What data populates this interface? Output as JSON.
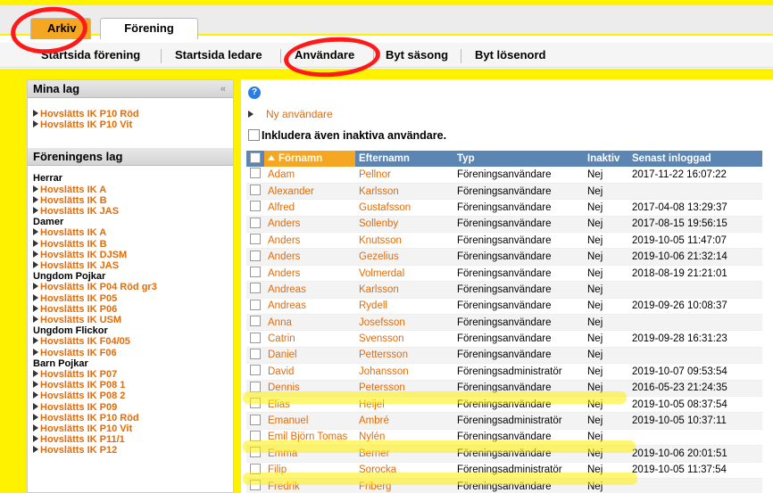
{
  "tabs": [
    {
      "label": "Arkiv",
      "active": true
    },
    {
      "label": "Förening",
      "active": false
    }
  ],
  "subnav": [
    "Startsida förening",
    "Startsida ledare",
    "Användare",
    "Byt säsong",
    "Byt lösenord"
  ],
  "sidebar": {
    "my_teams_title": "Mina lag",
    "collapse_icon": "«",
    "my_teams": [
      "Hovslätts IK P10 Röd",
      "Hovslätts IK P10 Vit"
    ],
    "club_teams_title": "Föreningens lag",
    "groups": [
      {
        "name": "Herrar",
        "teams": [
          "Hovslätts IK A",
          "Hovslätts IK B",
          "Hovslätts IK JAS"
        ]
      },
      {
        "name": "Damer",
        "teams": [
          "Hovslätts IK A",
          "Hovslätts IK B",
          "Hovslätts IK DJSM",
          "Hovslätts IK JAS"
        ]
      },
      {
        "name": "Ungdom Pojkar",
        "teams": [
          "Hovslätts IK P04 Röd gr3",
          "Hovslätts IK P05",
          "Hovslätts IK P06",
          "Hovslätts IK USM"
        ]
      },
      {
        "name": "Ungdom Flickor",
        "teams": [
          "Hovslätts IK F04/05",
          "Hovslätts IK F06"
        ]
      },
      {
        "name": "Barn Pojkar",
        "teams": [
          "Hovslätts IK P07",
          "Hovslätts IK P08 1",
          "Hovslätts IK P08 2",
          "Hovslätts IK P09",
          "Hovslätts IK P10 Röd",
          "Hovslätts IK P10 Vit",
          "Hovslätts IK P11/1",
          "Hovslätts IK P12"
        ]
      }
    ]
  },
  "main": {
    "help_icon": "?",
    "new_user_label": "Ny användare",
    "include_inactive_label": "Inkludera även inaktiva användare.",
    "columns": [
      "Förnamn",
      "Efternamn",
      "Typ",
      "Inaktiv",
      "Senast inloggad"
    ],
    "rows": [
      [
        "Adam",
        "Pellnor",
        "Föreningsanvändare",
        "Nej",
        "2017-11-22 16:07:22"
      ],
      [
        "Alexander",
        "Karlsson",
        "Föreningsanvändare",
        "Nej",
        ""
      ],
      [
        "Alfred",
        "Gustafsson",
        "Föreningsanvändare",
        "Nej",
        "2017-04-08 13:29:37"
      ],
      [
        "Anders",
        "Sollenby",
        "Föreningsanvändare",
        "Nej",
        "2017-08-15 19:56:15"
      ],
      [
        "Anders",
        "Knutsson",
        "Föreningsanvändare",
        "Nej",
        "2019-10-05 11:47:07"
      ],
      [
        "Anders",
        "Gezelius",
        "Föreningsanvändare",
        "Nej",
        "2019-10-06 21:32:14"
      ],
      [
        "Anders",
        "Volmerdal",
        "Föreningsanvändare",
        "Nej",
        "2018-08-19 21:21:01"
      ],
      [
        "Andreas",
        "Karlsson",
        "Föreningsanvändare",
        "Nej",
        ""
      ],
      [
        "Andreas",
        "Rydell",
        "Föreningsanvändare",
        "Nej",
        "2019-09-26 10:08:37"
      ],
      [
        "Anna",
        "Josefsson",
        "Föreningsanvändare",
        "Nej",
        ""
      ],
      [
        "Catrin",
        "Svensson",
        "Föreningsanvändare",
        "Nej",
        "2019-09-28 16:31:23"
      ],
      [
        "Daniel",
        "Pettersson",
        "Föreningsanvändare",
        "Nej",
        ""
      ],
      [
        "David",
        "Johansson",
        "Föreningsadministratör",
        "Nej",
        "2019-10-07 09:53:54"
      ],
      [
        "Dennis",
        "Petersson",
        "Föreningsanvändare",
        "Nej",
        "2016-05-23 21:24:35"
      ],
      [
        "Elias",
        "Heijel",
        "Föreningsanvändare",
        "Nej",
        "2019-10-05 08:37:54"
      ],
      [
        "Emanuel",
        "Ambré",
        "Föreningsadministratör",
        "Nej",
        "2019-10-05 10:37:11"
      ],
      [
        "Emil Björn Tomas",
        "Nylén",
        "Föreningsanvändare",
        "Nej",
        ""
      ],
      [
        "Emma",
        "Berner",
        "Föreningsanvändare",
        "Nej",
        "2019-10-06 20:01:51"
      ],
      [
        "Filip",
        "Sorocka",
        "Föreningsadministratör",
        "Nej",
        "2019-10-05 11:37:54"
      ],
      [
        "Fredrik",
        "Friberg",
        "Föreningsanvändare",
        "Nej",
        ""
      ]
    ]
  }
}
